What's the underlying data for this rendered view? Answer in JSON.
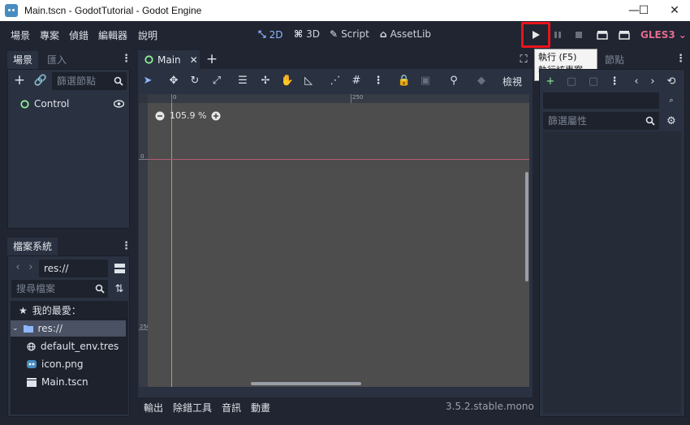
{
  "window": {
    "title": "Main.tscn - GodotTutorial - Godot Engine",
    "minimize": "—",
    "maximize": "☐",
    "close": "✕"
  },
  "menu": [
    "場景",
    "專案",
    "偵錯",
    "編輯器",
    "說明"
  ],
  "workspaces": {
    "w2d": "2D",
    "w3d": "3D",
    "script": "Script",
    "assetlib": "AssetLib"
  },
  "renderer": "GLES3",
  "scene_dock": {
    "tab_scene": "場景",
    "tab_import": "匯入",
    "filter_placeholder": "篩選節點",
    "root_node": "Control"
  },
  "filesystem_dock": {
    "tab": "檔案系統",
    "path": "res://",
    "search_placeholder": "搜尋檔案",
    "favorites": "我的最愛：",
    "root": "res://",
    "files": [
      "default_env.tres",
      "icon.png",
      "Main.tscn"
    ]
  },
  "editor": {
    "scene_tab": "Main",
    "view_menu": "檢視",
    "zoom": "105.9 %",
    "ruler_labels": [
      "0",
      "250"
    ],
    "ruler_left_labels": [
      "0",
      "250"
    ]
  },
  "tooltip": {
    "line1": "執行 (F5)",
    "line2": "執行該專案。"
  },
  "inspector": {
    "filter_placeholder": "篩選屬性",
    "tab_partial": "節點"
  },
  "bottom_panel": {
    "tabs": [
      "輸出",
      "除錯工具",
      "音訊",
      "動畫"
    ],
    "version": "3.5.2.stable.mono"
  },
  "colors": {
    "accent": "#8fb7ff",
    "highlight": "#e8141c",
    "renderer": "#e66b8f",
    "node_green": "#8eef97"
  }
}
